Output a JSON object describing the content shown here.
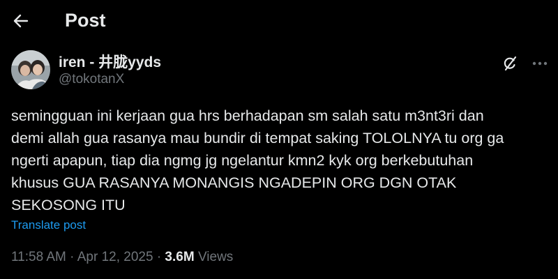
{
  "header": {
    "title": "Post",
    "back_icon": "arrow-left-icon"
  },
  "author": {
    "display_name": "iren - 井胧yyds",
    "handle": "@tokotanX",
    "avatar": "profile-photo",
    "grok_icon": "grok-icon",
    "more_icon": "more-horizontal-icon"
  },
  "post": {
    "lines": [
      "semingguan ini kerjaan gua hrs berhadapan sm salah satu m3nt3ri dan",
      "demi allah gua rasanya mau bundir di tempat saking TOLOLNYA tu org ga",
      "ngerti apapun, tiap dia ngmg jg ngelantur kmn2 kyk org berkebutuhan",
      "khusus GUA RASANYA MONANGIS NGADEPIN ORG DGN OTAK",
      "SEKOSONG ITU"
    ],
    "translate_label": "Translate post"
  },
  "meta": {
    "time": "11:58 AM",
    "separator": "·",
    "date": "Apr 12, 2025",
    "views_count": "3.6M",
    "views_label": "Views"
  },
  "colors": {
    "background": "#000000",
    "text": "#e7e9ea",
    "secondary": "#71767b",
    "link": "#1d9bf0"
  }
}
